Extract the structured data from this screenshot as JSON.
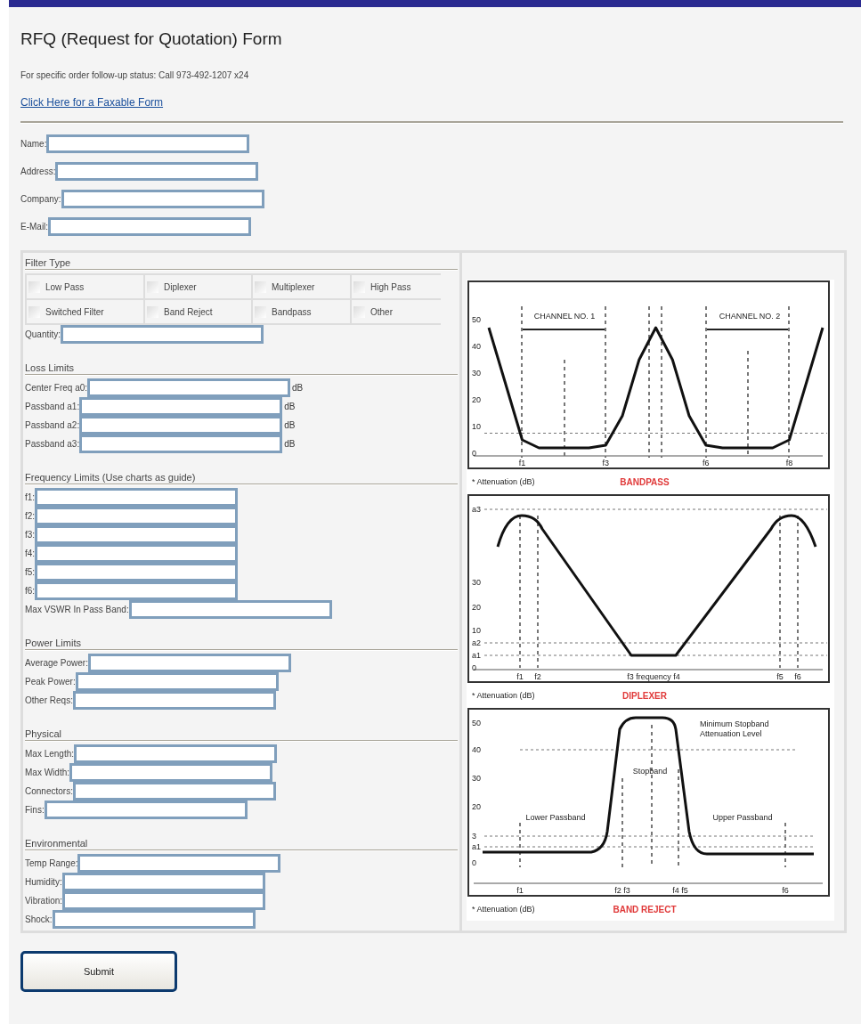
{
  "title": "RFQ (Request for Quotation) Form",
  "note": "For specific order follow-up status: Call 973-492-1207 x24",
  "link": "Click Here for a Faxable Form",
  "contact_fields": [
    {
      "label": "Name:"
    },
    {
      "label": "Address:"
    },
    {
      "label": "Company:"
    },
    {
      "label": "E-Mail:"
    }
  ],
  "filter_type": {
    "title": "Filter Type",
    "options": [
      {
        "label": "Low Pass",
        "checked": false
      },
      {
        "label": "Diplexer",
        "checked": false
      },
      {
        "label": "Multiplexer",
        "checked": false
      },
      {
        "label": "High Pass",
        "checked": false
      },
      {
        "label": "Switched Filter",
        "checked": false
      },
      {
        "label": "Band Reject",
        "checked": false
      },
      {
        "label": "Bandpass",
        "checked": false
      },
      {
        "label": "Other",
        "checked": false
      }
    ],
    "quantity_label": "Quantity:"
  },
  "sections": [
    {
      "title": "Loss Limits",
      "fields": [
        {
          "label": "Center Freq a0:",
          "suffix": "dB"
        },
        {
          "label": "Passband a1:",
          "suffix": "dB"
        },
        {
          "label": "Passband a2:",
          "suffix": "dB"
        },
        {
          "label": "Passband a3:",
          "suffix": "dB"
        }
      ]
    },
    {
      "title": "Frequency Limits (Use charts as guide)",
      "fields": [
        {
          "label": "f1:"
        },
        {
          "label": "f2:"
        },
        {
          "label": "f3:"
        },
        {
          "label": "f4:"
        },
        {
          "label": "f5:"
        },
        {
          "label": "f6:"
        },
        {
          "label": "Max VSWR In Pass Band:"
        }
      ]
    },
    {
      "title": "Power Limits",
      "fields": [
        {
          "label": "Average Power:"
        },
        {
          "label": "Peak Power:"
        },
        {
          "label": "Other Reqs:"
        }
      ]
    },
    {
      "title": "Physical",
      "fields": [
        {
          "label": "Max Length:"
        },
        {
          "label": "Max Width:"
        },
        {
          "label": "Connectors:"
        },
        {
          "label": "Fins:"
        }
      ]
    },
    {
      "title": "Environmental",
      "fields": [
        {
          "label": "Temp Range:"
        },
        {
          "label": "Humidity:"
        },
        {
          "label": "Vibration:"
        },
        {
          "label": "Shock:"
        }
      ]
    }
  ],
  "diagrams": [
    {
      "kind": "bandpass",
      "caption": "BANDPASS",
      "axis_note": "* Attenuation (dB)",
      "labels": [
        "CHANNEL NO. 1",
        "CHANNEL NO. 2"
      ],
      "chart_data": {
        "type": "line",
        "grid": true,
        "ref_lines": [
          {
            "axis": "y",
            "value": 7.5
          }
        ],
        "ylim": [
          0,
          50
        ],
        "yticks": [
          0,
          10,
          20,
          30,
          40,
          50
        ],
        "categories": [
          null,
          null,
          "f1",
          null,
          null,
          null,
          null,
          "f3",
          null,
          null,
          null,
          null,
          null,
          "f6",
          null,
          null,
          null,
          null,
          "f8",
          null,
          null
        ],
        "series": [
          {
            "color": "#111111",
            "values": [
              47,
              26,
              5,
              2,
              2,
              2,
              2,
              3,
              14,
              35,
              47,
              35,
              14,
              3,
              2,
              2,
              2,
              2,
              5,
              26,
              47
            ]
          }
        ]
      }
    },
    {
      "kind": "diplexer",
      "caption": "DIPLEXER",
      "axis_note": "* Attenuation (dB)",
      "yticks": [
        "a3",
        "30",
        "20",
        "10",
        "a2",
        "a1",
        "0"
      ],
      "labels": [
        "f3 frequency f4"
      ],
      "xlabels": [
        "f1",
        "f2",
        "f5",
        "f6"
      ]
    },
    {
      "kind": "bandreject",
      "caption": "BAND REJECT",
      "axis_note": "* Attenuation (dB)",
      "yticks": [
        "50",
        "40",
        "30",
        "20",
        "3",
        "a1",
        "0"
      ],
      "labels": [
        "Minimum Stopband",
        "Attenuation Level",
        "Stopband",
        "Lower Passband",
        "Upper Passband"
      ],
      "xlabels": [
        "f1",
        "f2 f3",
        "f4 f5",
        "f6"
      ]
    }
  ],
  "submit": "Submit"
}
